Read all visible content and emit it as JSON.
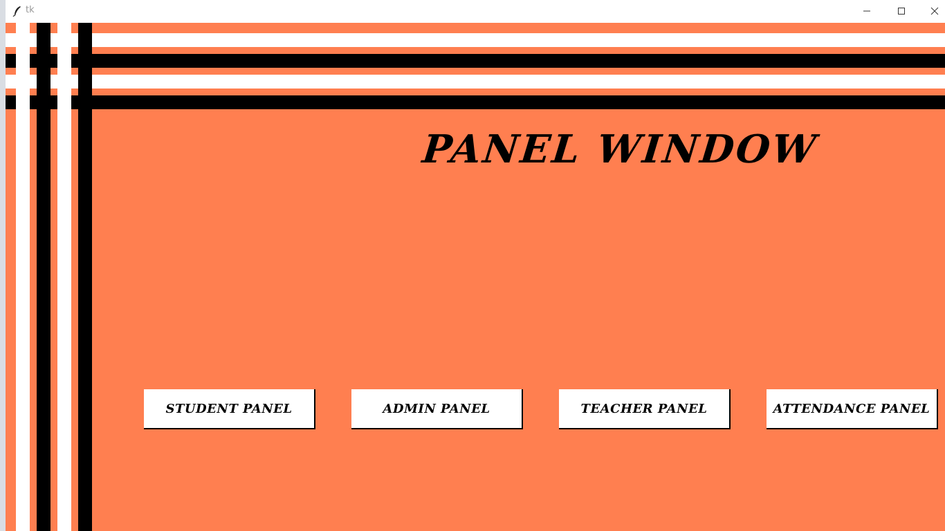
{
  "window": {
    "title": "tk",
    "icon": "feather-icon",
    "controls": {
      "minimize": "minimize-icon",
      "maximize": "maximize-icon",
      "close": "close-icon"
    }
  },
  "colors": {
    "background": "#ff7f50",
    "stripe_light": "#ffffff",
    "stripe_dark": "#000000",
    "button_bg": "#ffffff",
    "text": "#000000"
  },
  "main": {
    "heading": "PANEL WINDOW",
    "buttons": [
      {
        "label": "STUDENT PANEL"
      },
      {
        "label": "ADMIN PANEL"
      },
      {
        "label": "TEACHER PANEL"
      },
      {
        "label": "ATTENDANCE PANEL"
      }
    ]
  }
}
